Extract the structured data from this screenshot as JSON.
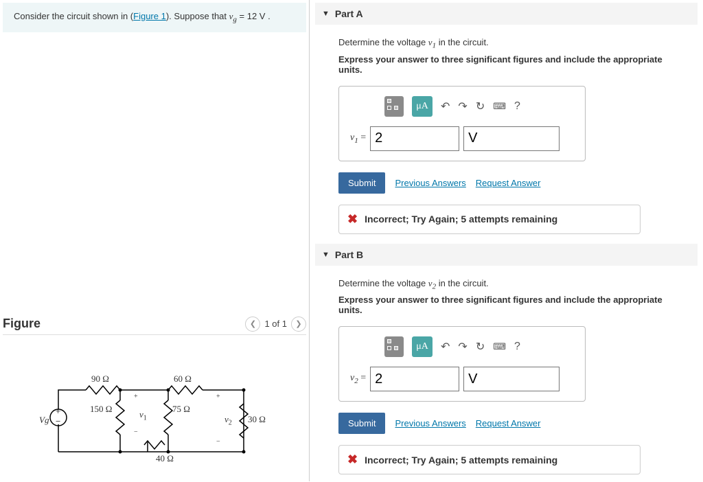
{
  "problem": {
    "prefix": "Consider the circuit shown in (",
    "figure_link": "Figure 1",
    "suffix": "). Suppose that ",
    "var": "v",
    "varsub": "g",
    "eq": " = 12  V ."
  },
  "figure": {
    "title": "Figure",
    "pager": "1 of 1"
  },
  "circuit": {
    "vg": "Vg",
    "r90": "90 Ω",
    "r150": "150 Ω",
    "r60": "60 Ω",
    "r75": "75 Ω",
    "r40": "40 Ω",
    "r30": "30 Ω",
    "v1": "v",
    "v1sub": "1",
    "v2": "v",
    "v2sub": "2"
  },
  "partA": {
    "title": "Part A",
    "prompt_pre": "Determine the voltage ",
    "prompt_var": "v",
    "prompt_sub": "1",
    "prompt_post": " in the circuit.",
    "instruct": "Express your answer to three significant figures and include the appropriate units.",
    "mu": "μA",
    "help": "?",
    "eq_var": "v",
    "eq_sub": "1",
    "eq_sym": " = ",
    "value": "2",
    "unit": "V",
    "submit": "Submit",
    "prev": "Previous Answers",
    "req": "Request Answer",
    "feedback": "Incorrect; Try Again; 5 attempts remaining"
  },
  "partB": {
    "title": "Part B",
    "prompt_pre": "Determine the voltage ",
    "prompt_var": "v",
    "prompt_sub": "2",
    "prompt_post": " in the circuit.",
    "instruct": "Express your answer to three significant figures and include the appropriate units.",
    "mu": "μA",
    "help": "?",
    "eq_var": "v",
    "eq_sub": "2",
    "eq_sym": " = ",
    "value": "2",
    "unit": "V",
    "submit": "Submit",
    "prev": "Previous Answers",
    "req": "Request Answer",
    "feedback": "Incorrect; Try Again; 5 attempts remaining"
  }
}
